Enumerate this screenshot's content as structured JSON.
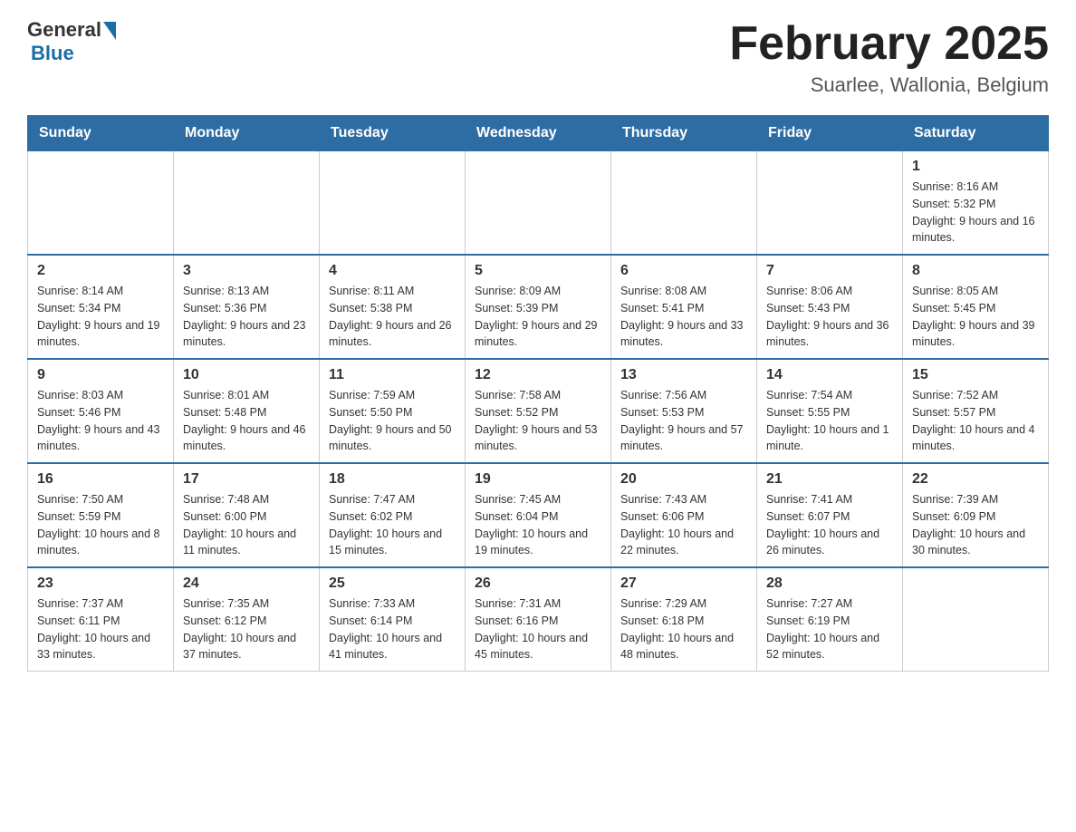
{
  "header": {
    "logo_text_general": "General",
    "logo_text_blue": "Blue",
    "month_title": "February 2025",
    "subtitle": "Suarlee, Wallonia, Belgium"
  },
  "weekdays": [
    "Sunday",
    "Monday",
    "Tuesday",
    "Wednesday",
    "Thursday",
    "Friday",
    "Saturday"
  ],
  "weeks": [
    [
      {
        "day": "",
        "info": ""
      },
      {
        "day": "",
        "info": ""
      },
      {
        "day": "",
        "info": ""
      },
      {
        "day": "",
        "info": ""
      },
      {
        "day": "",
        "info": ""
      },
      {
        "day": "",
        "info": ""
      },
      {
        "day": "1",
        "info": "Sunrise: 8:16 AM\nSunset: 5:32 PM\nDaylight: 9 hours and 16 minutes."
      }
    ],
    [
      {
        "day": "2",
        "info": "Sunrise: 8:14 AM\nSunset: 5:34 PM\nDaylight: 9 hours and 19 minutes."
      },
      {
        "day": "3",
        "info": "Sunrise: 8:13 AM\nSunset: 5:36 PM\nDaylight: 9 hours and 23 minutes."
      },
      {
        "day": "4",
        "info": "Sunrise: 8:11 AM\nSunset: 5:38 PM\nDaylight: 9 hours and 26 minutes."
      },
      {
        "day": "5",
        "info": "Sunrise: 8:09 AM\nSunset: 5:39 PM\nDaylight: 9 hours and 29 minutes."
      },
      {
        "day": "6",
        "info": "Sunrise: 8:08 AM\nSunset: 5:41 PM\nDaylight: 9 hours and 33 minutes."
      },
      {
        "day": "7",
        "info": "Sunrise: 8:06 AM\nSunset: 5:43 PM\nDaylight: 9 hours and 36 minutes."
      },
      {
        "day": "8",
        "info": "Sunrise: 8:05 AM\nSunset: 5:45 PM\nDaylight: 9 hours and 39 minutes."
      }
    ],
    [
      {
        "day": "9",
        "info": "Sunrise: 8:03 AM\nSunset: 5:46 PM\nDaylight: 9 hours and 43 minutes."
      },
      {
        "day": "10",
        "info": "Sunrise: 8:01 AM\nSunset: 5:48 PM\nDaylight: 9 hours and 46 minutes."
      },
      {
        "day": "11",
        "info": "Sunrise: 7:59 AM\nSunset: 5:50 PM\nDaylight: 9 hours and 50 minutes."
      },
      {
        "day": "12",
        "info": "Sunrise: 7:58 AM\nSunset: 5:52 PM\nDaylight: 9 hours and 53 minutes."
      },
      {
        "day": "13",
        "info": "Sunrise: 7:56 AM\nSunset: 5:53 PM\nDaylight: 9 hours and 57 minutes."
      },
      {
        "day": "14",
        "info": "Sunrise: 7:54 AM\nSunset: 5:55 PM\nDaylight: 10 hours and 1 minute."
      },
      {
        "day": "15",
        "info": "Sunrise: 7:52 AM\nSunset: 5:57 PM\nDaylight: 10 hours and 4 minutes."
      }
    ],
    [
      {
        "day": "16",
        "info": "Sunrise: 7:50 AM\nSunset: 5:59 PM\nDaylight: 10 hours and 8 minutes."
      },
      {
        "day": "17",
        "info": "Sunrise: 7:48 AM\nSunset: 6:00 PM\nDaylight: 10 hours and 11 minutes."
      },
      {
        "day": "18",
        "info": "Sunrise: 7:47 AM\nSunset: 6:02 PM\nDaylight: 10 hours and 15 minutes."
      },
      {
        "day": "19",
        "info": "Sunrise: 7:45 AM\nSunset: 6:04 PM\nDaylight: 10 hours and 19 minutes."
      },
      {
        "day": "20",
        "info": "Sunrise: 7:43 AM\nSunset: 6:06 PM\nDaylight: 10 hours and 22 minutes."
      },
      {
        "day": "21",
        "info": "Sunrise: 7:41 AM\nSunset: 6:07 PM\nDaylight: 10 hours and 26 minutes."
      },
      {
        "day": "22",
        "info": "Sunrise: 7:39 AM\nSunset: 6:09 PM\nDaylight: 10 hours and 30 minutes."
      }
    ],
    [
      {
        "day": "23",
        "info": "Sunrise: 7:37 AM\nSunset: 6:11 PM\nDaylight: 10 hours and 33 minutes."
      },
      {
        "day": "24",
        "info": "Sunrise: 7:35 AM\nSunset: 6:12 PM\nDaylight: 10 hours and 37 minutes."
      },
      {
        "day": "25",
        "info": "Sunrise: 7:33 AM\nSunset: 6:14 PM\nDaylight: 10 hours and 41 minutes."
      },
      {
        "day": "26",
        "info": "Sunrise: 7:31 AM\nSunset: 6:16 PM\nDaylight: 10 hours and 45 minutes."
      },
      {
        "day": "27",
        "info": "Sunrise: 7:29 AM\nSunset: 6:18 PM\nDaylight: 10 hours and 48 minutes."
      },
      {
        "day": "28",
        "info": "Sunrise: 7:27 AM\nSunset: 6:19 PM\nDaylight: 10 hours and 52 minutes."
      },
      {
        "day": "",
        "info": ""
      }
    ]
  ]
}
